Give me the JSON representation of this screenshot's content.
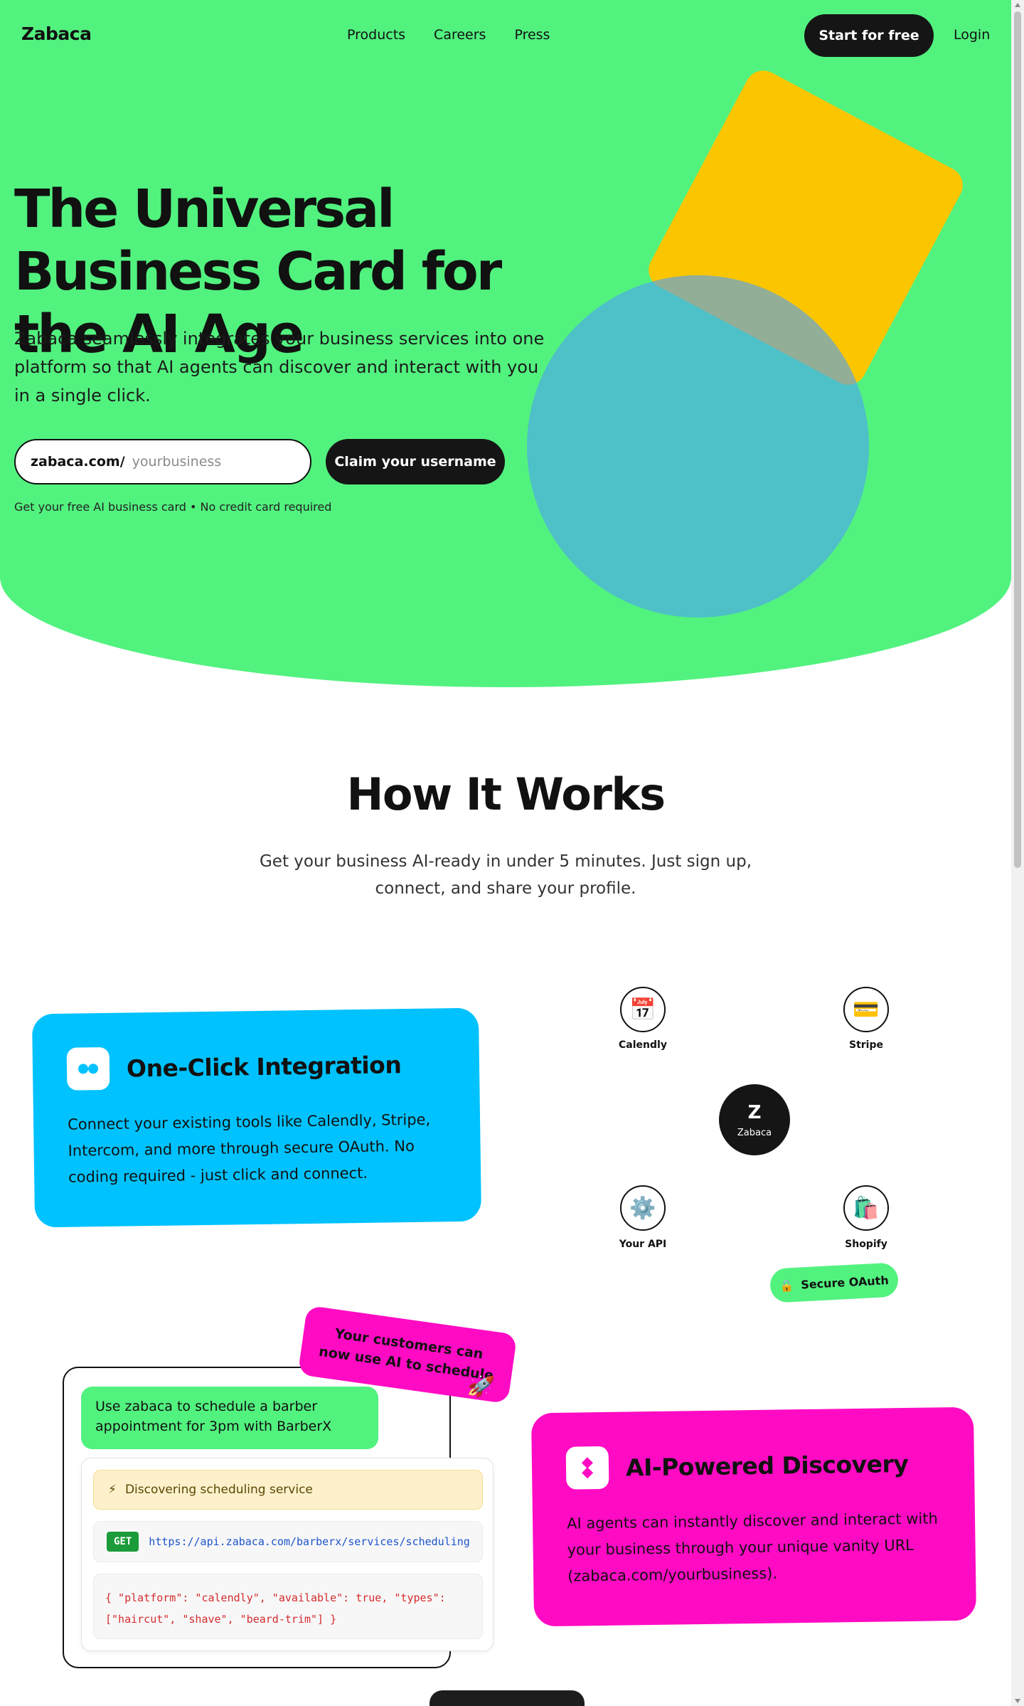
{
  "nav": {
    "logo": "Zabaca",
    "links": [
      "Products",
      "Careers",
      "Press"
    ],
    "start_label": "Start for free",
    "login_label": "Login"
  },
  "hero": {
    "title": "The Universal Business Card for the AI Age",
    "subtitle": "Zabaca seamlessly integrates your business services into one platform so that AI agents can discover and interact with you in a single click.",
    "claim_prefix": "zabaca.com/",
    "claim_placeholder": "yourbusiness",
    "claim_button": "Claim your username",
    "note": "Get your free AI business card • No credit card required"
  },
  "how": {
    "title": "How It Works",
    "subtitle": "Get your business AI-ready in under 5 minutes. Just sign up, connect, and share your profile."
  },
  "integration_card": {
    "title": "One-Click Integration",
    "text": "Connect your existing tools like Calendly, Stripe, Intercom, and more through secure OAuth. No coding required - just click and connect."
  },
  "diagram": {
    "nodes": [
      {
        "label": "Calendly",
        "icon": "calendar-icon",
        "glyph": "📅"
      },
      {
        "label": "Stripe",
        "icon": "credit-card-icon",
        "glyph": "💳"
      },
      {
        "label": "Your API",
        "icon": "gear-icon",
        "glyph": "⚙️"
      },
      {
        "label": "Shopify",
        "icon": "shopping-bag-icon",
        "glyph": "🛍️"
      }
    ],
    "center_letter": "Z",
    "center_label": "Zabaca",
    "oauth_label": "Secure OAuth",
    "oauth_glyph": "🔒"
  },
  "demo": {
    "user_message": "Use zabaca to schedule a barber appointment for 3pm with BarberX",
    "discovering": "Discovering scheduling service",
    "discover_glyph": "⚡",
    "method": "GET",
    "url": "https://api.zabaca.com/barberx/services/scheduling",
    "json_line1": "{ \"platform\": \"calendly\", \"available\": true, \"types\":",
    "json_line2": "[\"haircut\", \"shave\", \"beard-trim\"] }",
    "pill_text": "Your customers can now use AI to schedule",
    "pill_glyph": "🚀"
  },
  "discovery_card": {
    "title": "AI-Powered Discovery",
    "text": "AI agents can instantly discover and interact with your business through your unique vanity URL (zabaca.com/yourbusiness)."
  },
  "colors": {
    "hero_green": "#52f27f",
    "yellow": "#fbc600",
    "teal": "#4ec0c8",
    "blue": "#00c2ff",
    "pink": "#ff0bc4",
    "dark": "#151515"
  }
}
